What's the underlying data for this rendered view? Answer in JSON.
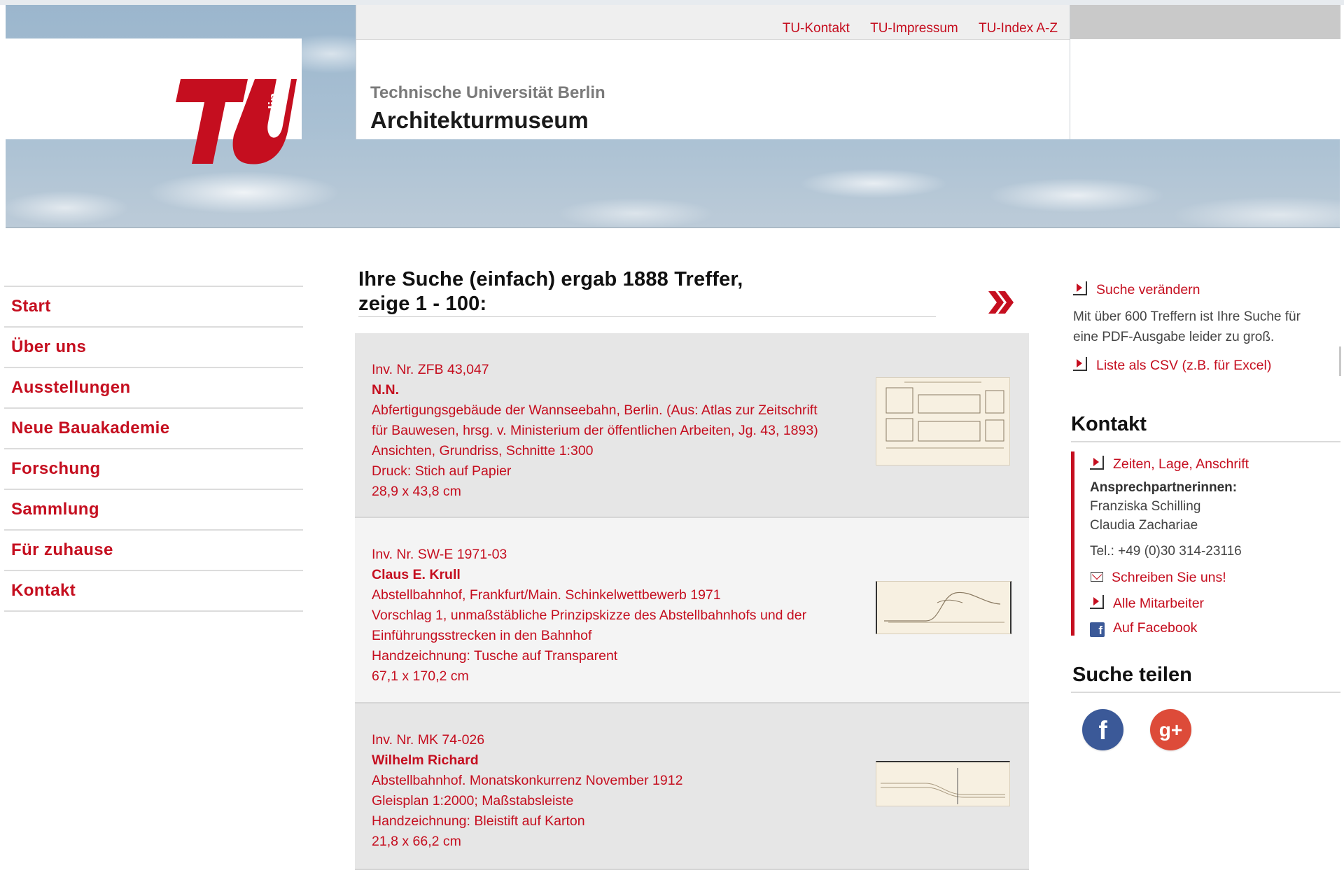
{
  "header": {
    "top_links": [
      "TU-Kontakt",
      "TU-Impressum",
      "TU-Index A-Z"
    ],
    "institution": "Technische Universität Berlin",
    "museum": "Architekturmuseum",
    "logo_text": "berlin"
  },
  "nav": [
    "Start",
    "Über uns",
    "Ausstellungen",
    "Neue Bauakademie",
    "Forschung",
    "Sammlung",
    "Für zuhause",
    "Kontakt"
  ],
  "results": {
    "heading_line1": "Ihre Suche (einfach) ergab 1888 Treffer,",
    "heading_line2": "zeige 1 - 100:",
    "next_icon": "double-chevron-right-icon",
    "items": [
      {
        "inv": "Inv. Nr. ZFB 43,047",
        "name": "N.N.",
        "lines": [
          "Abfertigungsgebäude der Wannseebahn, Berlin. (Aus: Atlas zur Zeitschrift",
          "für Bauwesen, hrsg. v. Ministerium der öffentlichen Arbeiten, Jg. 43, 1893)",
          "Ansichten, Grundriss, Schnitte 1:300",
          "Druck: Stich auf Papier",
          "28,9 x 43,8 cm"
        ]
      },
      {
        "inv": "Inv. Nr. SW-E 1971-03",
        "name": "Claus E. Krull",
        "lines": [
          "Abstellbahnhof, Frankfurt/Main. Schinkelwettbewerb 1971",
          "Vorschlag 1, unmaßstäbliche Prinzipskizze des Abstellbahnhofs und der",
          "Einführungsstrecken in den Bahnhof",
          "Handzeichnung: Tusche auf Transparent",
          "67,1 x 170,2 cm"
        ]
      },
      {
        "inv": "Inv. Nr. MK 74-026",
        "name": "Wilhelm Richard",
        "lines": [
          "Abstellbahnhof. Monatskonkurrenz November 1912",
          "Gleisplan 1:2000; Maßstabsleiste",
          "Handzeichnung: Bleistift auf Karton",
          "21,8 x 66,2 cm"
        ]
      }
    ]
  },
  "sidebar": {
    "change_search": "Suche verändern",
    "pdf_note_line1": "Mit über 600 Treffern ist Ihre Suche für",
    "pdf_note_line2": "eine PDF-Ausgabe leider zu groß.",
    "csv_link": "Liste als CSV (z.B. für Excel)",
    "kontakt_heading": "Kontakt",
    "zeiten_link": "Zeiten, Lage, Anschrift",
    "contacts_label": "Ansprechpartnerinnen:",
    "contact_1": "Franziska Schilling",
    "contact_2": "Claudia Zachariae",
    "phone": "Tel.: +49 (0)30 314-23116",
    "write_link": "Schreiben Sie uns!",
    "staff_link": "Alle Mitarbeiter",
    "facebook_link": "Auf Facebook",
    "share_heading": "Suche teilen",
    "share_facebook_glyph": "f",
    "share_gplus_glyph": "g+"
  },
  "colors": {
    "brand_red": "#c50e1f",
    "facebook_blue": "#3b5998",
    "gplus_red": "#dd4b39"
  }
}
